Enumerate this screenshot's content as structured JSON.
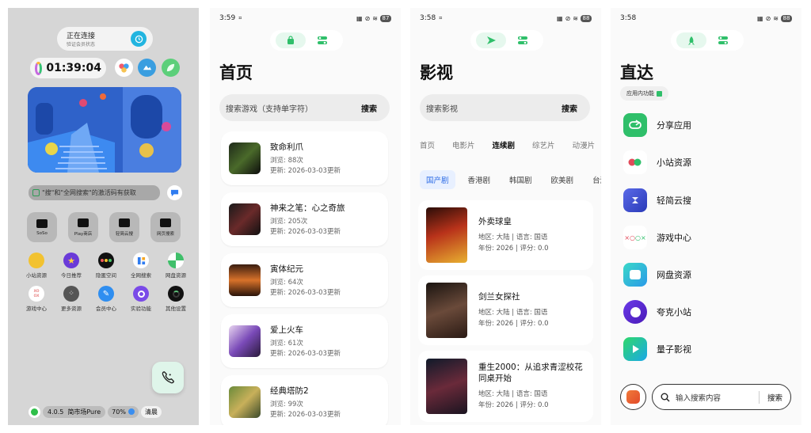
{
  "panel1": {
    "connect_title": "正在连接",
    "connect_sub": "验证会员状态",
    "timer": "01:39:04",
    "search_text": "\"搜\"和\"全网搜索\"的激活码有获取",
    "app_tiles": [
      {
        "label": "SoSo"
      },
      {
        "label": "Play商店"
      },
      {
        "label": "轻简云搜"
      },
      {
        "label": "网页搜索"
      }
    ],
    "grid_row1": [
      {
        "label": "小站资源"
      },
      {
        "label": "今日推荐"
      },
      {
        "label": "隐匿空间"
      },
      {
        "label": "全网搜索"
      },
      {
        "label": "网盘资源"
      }
    ],
    "grid_row2": [
      {
        "label": "游戏中心"
      },
      {
        "label": "更多资源"
      },
      {
        "label": "会员中心"
      },
      {
        "label": "实验功能"
      },
      {
        "label": "其他设置"
      }
    ],
    "version": "4.0.5",
    "market": "简市场Pure",
    "percent": "70%",
    "clean": "清晨"
  },
  "panel2": {
    "time": "3:59",
    "battery": "87",
    "title": "首页",
    "search_placeholder": "搜索游戏（支持单字符）",
    "search_btn": "搜索",
    "items": [
      {
        "title": "致命利爪",
        "views": "浏览: 88次",
        "updated": "更新: 2026-03-03更新"
      },
      {
        "title": "神来之笔：心之奇旅",
        "views": "浏览: 205次",
        "updated": "更新: 2026-03-03更新"
      },
      {
        "title": "寅体纪元",
        "views": "浏览: 64次",
        "updated": "更新: 2026-03-03更新"
      },
      {
        "title": "爱上火车",
        "views": "浏览: 61次",
        "updated": "更新: 2026-03-03更新"
      },
      {
        "title": "经典塔防2",
        "views": "浏览: 99次",
        "updated": "更新: 2026-03-03更新"
      }
    ]
  },
  "panel3": {
    "time": "3:58",
    "battery": "88",
    "title": "影视",
    "search_placeholder": "搜索影视",
    "search_btn": "搜索",
    "tabs": [
      "首页",
      "电影片",
      "连续剧",
      "综艺片",
      "动漫片"
    ],
    "subtabs": [
      "国产剧",
      "香港剧",
      "韩国剧",
      "欧美剧",
      "台湾剧"
    ],
    "movies": [
      {
        "title": "外卖球皇",
        "meta1": "地区: 大陆 | 语言: 国语",
        "meta2": "年份: 2026 | 评分: 0.0"
      },
      {
        "title": "剑兰女探社",
        "meta1": "地区: 大陆 | 语言: 国语",
        "meta2": "年份: 2026 | 评分: 0.0"
      },
      {
        "title": "重生2000：从追求青涩校花同桌开始",
        "meta1": "地区: 大陆 | 语言: 国语",
        "meta2": "年份: 2026 | 评分: 0.0"
      }
    ]
  },
  "panel4": {
    "time": "3:58",
    "battery": "88",
    "title": "直达",
    "chip": "应用内功能",
    "items": [
      {
        "label": "分享应用"
      },
      {
        "label": "小站资源"
      },
      {
        "label": "轻简云搜"
      },
      {
        "label": "游戏中心"
      },
      {
        "label": "网盘资源"
      },
      {
        "label": "夸克小站"
      },
      {
        "label": "量子影视"
      }
    ],
    "search_placeholder": "输入搜索内容",
    "search_btn": "搜索"
  }
}
